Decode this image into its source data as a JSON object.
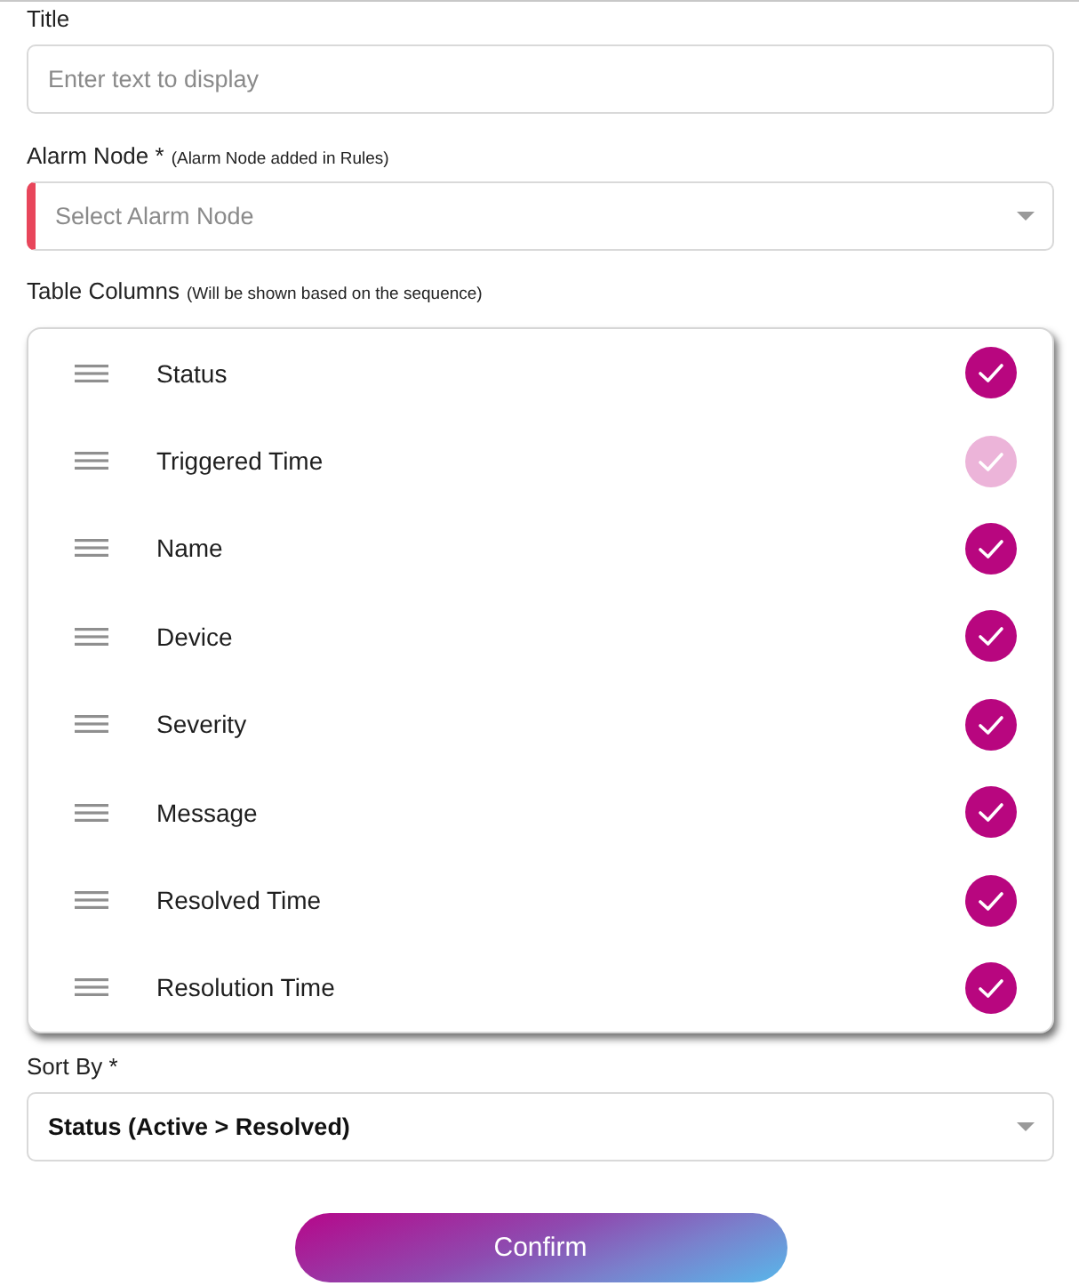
{
  "title_field": {
    "label": "Title",
    "placeholder": "Enter text to display"
  },
  "alarm_node_field": {
    "label": "Alarm Node *",
    "hint": "(Alarm Node added in Rules)",
    "placeholder": "Select Alarm Node",
    "invalid": true
  },
  "table_columns": {
    "label": "Table Columns",
    "hint": "(Will be shown based on the sequence)",
    "items": [
      {
        "name": "Status",
        "checked": true,
        "disabled": false
      },
      {
        "name": "Triggered Time",
        "checked": true,
        "disabled": true
      },
      {
        "name": "Name",
        "checked": true,
        "disabled": false
      },
      {
        "name": "Device",
        "checked": true,
        "disabled": false
      },
      {
        "name": "Severity",
        "checked": true,
        "disabled": false
      },
      {
        "name": "Message",
        "checked": true,
        "disabled": false
      },
      {
        "name": "Resolved Time",
        "checked": true,
        "disabled": false
      },
      {
        "name": "Resolution Time",
        "checked": true,
        "disabled": false
      }
    ]
  },
  "sort_by_field": {
    "label": "Sort By *",
    "value": "Status (Active > Resolved)"
  },
  "confirm_button": {
    "label": "Confirm"
  }
}
